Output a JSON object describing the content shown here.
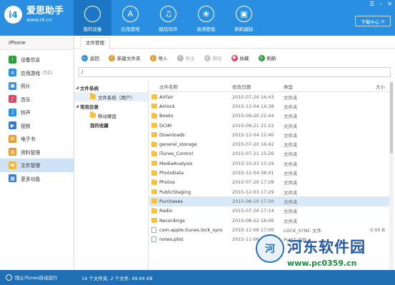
{
  "brand": {
    "logo": "i4",
    "name": "爱思助手",
    "url": "www.i4.cn"
  },
  "nav": [
    {
      "label": "我的设备",
      "icon": "apple-icon",
      "glyph": ""
    },
    {
      "label": "应用游戏",
      "icon": "app-store-icon",
      "glyph": "A"
    },
    {
      "label": "酷炫铃声",
      "icon": "music-icon",
      "glyph": "♫"
    },
    {
      "label": "高清壁纸",
      "icon": "wallpaper-icon",
      "glyph": "❀"
    },
    {
      "label": "刷机越狱",
      "icon": "flash-box-icon",
      "glyph": "▣"
    }
  ],
  "window": {
    "download_center": "下载中心",
    "dl_glyph": "⊙"
  },
  "device": "iPhone",
  "sidebar": {
    "items": [
      {
        "label": "设备信息",
        "count": "",
        "icon": "info-icon",
        "glyph": "i",
        "color": "#2e9e3e"
      },
      {
        "label": "应用游戏",
        "count": "(52)",
        "icon": "apps-icon",
        "glyph": "A",
        "color": "#2a8fe0"
      },
      {
        "label": "照片",
        "count": "",
        "icon": "photo-icon",
        "glyph": "▣",
        "color": "#3c8ad9"
      },
      {
        "label": "音乐",
        "count": "",
        "icon": "music-icon",
        "glyph": "♪",
        "color": "#e0475f"
      },
      {
        "label": "铃声",
        "count": "",
        "icon": "bell-icon",
        "glyph": "♫",
        "color": "#2a8fe0"
      },
      {
        "label": "视频",
        "count": "",
        "icon": "video-icon",
        "glyph": "▶",
        "color": "#3a78c9"
      },
      {
        "label": "电子书",
        "count": "",
        "icon": "ebook-icon",
        "glyph": "▤",
        "color": "#e59a2b"
      },
      {
        "label": "资料管理",
        "count": "",
        "icon": "data-icon",
        "glyph": "▥",
        "color": "#e59a2b"
      },
      {
        "label": "文件管理",
        "count": "",
        "icon": "folder-icon",
        "glyph": "▬",
        "color": "#f0b93a"
      },
      {
        "label": "更多功能",
        "count": "",
        "icon": "more-icon",
        "glyph": "▦",
        "color": "#3a78c9"
      }
    ]
  },
  "tab": "文件管理",
  "toolbar": [
    {
      "label": "返回",
      "icon": "back-icon",
      "glyph": "←",
      "color": "#2a8fe0",
      "disabled": false
    },
    {
      "label": "新建文件夹",
      "icon": "new-folder-icon",
      "glyph": "+",
      "color": "#e59a2b",
      "disabled": false
    },
    {
      "label": "导入",
      "icon": "import-icon",
      "glyph": "↓",
      "color": "#e59a2b",
      "disabled": false
    },
    {
      "label": "导出",
      "icon": "export-icon",
      "glyph": "↑",
      "color": "#b9b9b9",
      "disabled": true
    },
    {
      "label": "删除",
      "icon": "delete-icon",
      "glyph": "×",
      "color": "#c4c4c4",
      "disabled": true
    },
    {
      "label": "收藏",
      "icon": "heart-icon",
      "glyph": "♥",
      "color": "#e0475f",
      "disabled": false
    },
    {
      "label": "刷新",
      "icon": "refresh-icon",
      "glyph": "↻",
      "color": "#2e9e3e",
      "disabled": false
    }
  ],
  "path": "/",
  "tree": {
    "fs_label": "文件系统",
    "fs_user": "文件系统（用户）",
    "common_label": "常用目录",
    "common_item": "移动硬盘",
    "favorites": "我的收藏"
  },
  "columns": {
    "name": "文件名称",
    "date": "修改日期",
    "type": "类型",
    "size": "大小"
  },
  "files": [
    {
      "name": "Airfair",
      "date": "2015-07-20 16:43",
      "type": "文件夹",
      "size": "",
      "kind": "folder"
    },
    {
      "name": "Airlock",
      "date": "2015-12-04 14:38",
      "type": "文件夹",
      "size": "",
      "kind": "folder"
    },
    {
      "name": "Books",
      "date": "2015-09-20 22:44",
      "type": "文件夹",
      "size": "",
      "kind": "folder"
    },
    {
      "name": "DCIM",
      "date": "2015-09-21 21:22",
      "type": "文件夹",
      "size": "",
      "kind": "folder"
    },
    {
      "name": "Downloads",
      "date": "2015-12-04 12:40",
      "type": "文件夹",
      "size": "",
      "kind": "folder"
    },
    {
      "name": "general_storage",
      "date": "2015-07-20 16:42",
      "type": "文件夹",
      "size": "",
      "kind": "folder"
    },
    {
      "name": "iTunes_Control",
      "date": "2015-07-21 15:26",
      "type": "文件夹",
      "size": "",
      "kind": "folder"
    },
    {
      "name": "MediaAnalysis",
      "date": "2015-10-23 15:29",
      "type": "文件夹",
      "size": "",
      "kind": "folder"
    },
    {
      "name": "PhotoData",
      "date": "2015-12-04 08:41",
      "type": "文件夹",
      "size": "",
      "kind": "folder"
    },
    {
      "name": "Photos",
      "date": "2015-07-20 17:28",
      "type": "文件夹",
      "size": "",
      "kind": "folder"
    },
    {
      "name": "PublicStaging",
      "date": "2015-12-03 17:29",
      "type": "文件夹",
      "size": "",
      "kind": "folder"
    },
    {
      "name": "Purchases",
      "date": "2015-08-10 17:50",
      "type": "文件夹",
      "size": "",
      "kind": "folder"
    },
    {
      "name": "Radio",
      "date": "2015-07-20 17:14",
      "type": "文件夹",
      "size": "",
      "kind": "folder"
    },
    {
      "name": "Recordings",
      "date": "2015-08-22 18:06",
      "type": "文件夹",
      "size": "",
      "kind": "folder"
    },
    {
      "name": "com.apple.itunes.lock_sync",
      "date": "2015-11-06 17:00",
      "type": "LOCK_SYNC 文件",
      "size": "0.00 B",
      "kind": "file"
    },
    {
      "name": "notes.plist",
      "date": "2015-11-06 17:00",
      "type": "PLIST 文件",
      "size": "",
      "kind": "file"
    }
  ],
  "status": {
    "itunes_label": "阻止iTunes自动运行",
    "stats": "14 个文件夹, 2 个文件, 49.94 KB"
  },
  "watermark": {
    "logo": "河",
    "title": "河东软件园",
    "url": "www.pc0359.cn"
  },
  "colors": {
    "header": "#2a8fe0",
    "statusbar": "#1f6fb5",
    "selected_row": "#d9e8f6"
  }
}
